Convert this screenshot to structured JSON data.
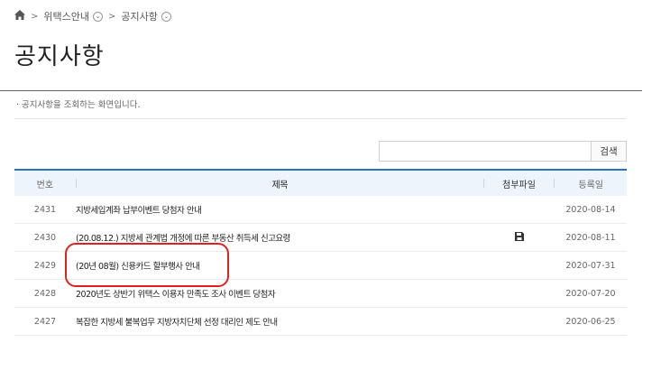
{
  "breadcrumb": {
    "home_icon": "home-icon",
    "separator": ">",
    "level1": "위택스안내",
    "level2": "공지사항"
  },
  "page_title": "공지사항",
  "description": "· 공지사항을 조회하는 화면입니다.",
  "search": {
    "value": "",
    "placeholder": "",
    "button_label": "검색"
  },
  "table": {
    "headers": {
      "no": "번호",
      "title": "제목",
      "attachment": "첨부파일",
      "date": "등록일"
    },
    "rows": [
      {
        "no": "2431",
        "title": "지방세입계좌 납부이벤트 당첨자 안내",
        "attachment": false,
        "date": "2020-08-14"
      },
      {
        "no": "2430",
        "title": "(20.08.12.) 지방세 관계법 개정에 따른 부동산 취득세 신고요령",
        "attachment": true,
        "date": "2020-08-11"
      },
      {
        "no": "2429",
        "title": "(20년 08월) 신용카드 할부행사 안내",
        "attachment": false,
        "date": "2020-07-31"
      },
      {
        "no": "2428",
        "title": "2020년도 상반기 위택스 이용자 만족도 조사 이벤트 당첨자",
        "attachment": false,
        "date": "2020-07-20"
      },
      {
        "no": "2427",
        "title": "복잡한 지방세 불복업무 지방자치단체 선정 대리인 제도 안내",
        "attachment": false,
        "date": "2020-06-25"
      }
    ]
  },
  "colors": {
    "header_border": "#2e6fb5",
    "header_bg": "#eef4fb",
    "highlight": "#e02020"
  }
}
